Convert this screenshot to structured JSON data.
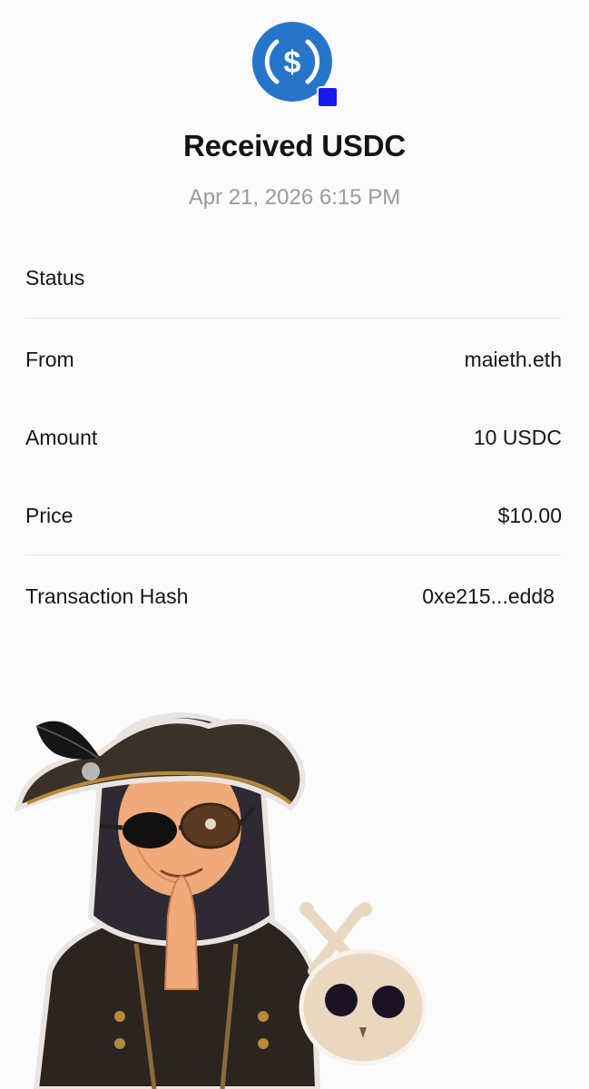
{
  "header": {
    "token_icon": "usdc-coin-icon",
    "title": "Received USDC",
    "date": "Apr 21, 2026 6:15 PM"
  },
  "details": {
    "status": {
      "label": "Status",
      "value": ""
    },
    "from": {
      "label": "From",
      "value": "maieth.eth"
    },
    "amount": {
      "label": "Amount",
      "value": "10 USDC"
    },
    "price": {
      "label": "Price",
      "value": "$10.00"
    },
    "hash": {
      "label": "Transaction Hash",
      "value": "0xe215...edd8"
    }
  },
  "illustration": {
    "subject": "pirate-character-sticker",
    "secondary": "skull-crossbones-sticker"
  },
  "colors": {
    "usdc_blue": "#2775ca",
    "network_badge": "#1a1af0",
    "divider": "#e8e8ea",
    "muted_text": "#9a9a9a"
  }
}
